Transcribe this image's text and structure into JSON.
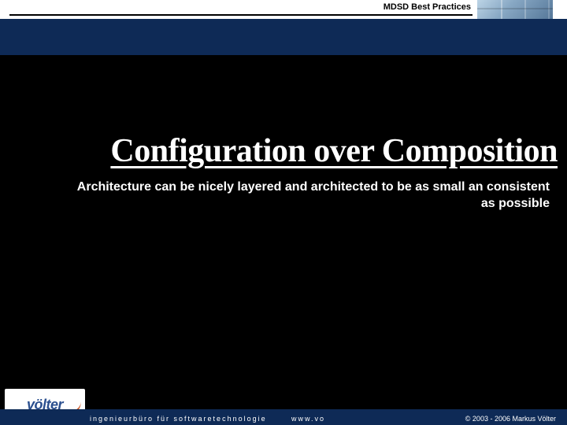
{
  "header": {
    "label": "MDSD Best Practices"
  },
  "slide": {
    "title": "Configuration over Composition",
    "subtitle": "Architecture can be nicely layered and architected to be as small an consistent as possible"
  },
  "footer": {
    "tagline": "ingenieurbüro für softwaretechnologie",
    "url": "www.vo",
    "copyright": "© 2003 - 2006 Markus Völter"
  },
  "logo": {
    "text": "völter"
  }
}
